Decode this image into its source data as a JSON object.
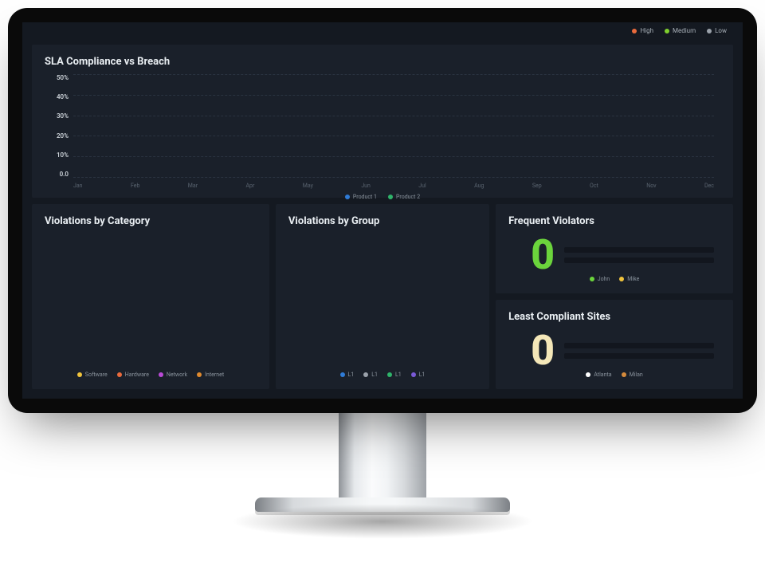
{
  "topLegend": [
    {
      "label": "High",
      "color": "#e96a3c"
    },
    {
      "label": "Medium",
      "color": "#7fcf2e"
    },
    {
      "label": "Low",
      "color": "#9aa1aa"
    }
  ],
  "topTicks": [
    "",
    "",
    "",
    ""
  ],
  "chart_data": {
    "type": "line",
    "title": "SLA Compliance vs Breach",
    "categories": [
      "Jan",
      "Feb",
      "Mar",
      "Apr",
      "May",
      "Jun",
      "Jul",
      "Aug",
      "Sep",
      "Oct",
      "Nov",
      "Dec"
    ],
    "series": [
      {
        "name": "Product 1",
        "color": "#2f7bd6",
        "values": [
          0,
          0,
          0,
          0,
          0,
          0,
          0,
          0,
          0,
          0,
          0,
          0
        ]
      },
      {
        "name": "Product 2",
        "color": "#2fb36a",
        "values": [
          0,
          0,
          0,
          0,
          0,
          0,
          0,
          0,
          0,
          0,
          0,
          0
        ]
      }
    ],
    "yTicks": [
      "50%",
      "40%",
      "30%",
      "20%",
      "10%",
      "0.0"
    ],
    "ylim": [
      0,
      50
    ],
    "ylabel": "",
    "xlabel": ""
  },
  "violationsCategory": {
    "title": "Violations by Category",
    "legend": [
      {
        "label": "Software",
        "color": "#f0c33c"
      },
      {
        "label": "Hardware",
        "color": "#e96a3c"
      },
      {
        "label": "Network",
        "color": "#b94ad6"
      },
      {
        "label": "Internet",
        "color": "#e08a2e"
      }
    ]
  },
  "violationsGroup": {
    "title": "Violations by Group",
    "legend": [
      {
        "label": "L1",
        "color": "#2f7bd6"
      },
      {
        "label": "L1",
        "color": "#9aa1aa"
      },
      {
        "label": "L1",
        "color": "#2fb36a"
      },
      {
        "label": "L1",
        "color": "#7a5ad6"
      }
    ]
  },
  "frequentViolators": {
    "title": "Frequent Violators",
    "value": "0",
    "legend": [
      {
        "label": "John",
        "color": "#6bd43c"
      },
      {
        "label": "Mike",
        "color": "#f0c33c"
      }
    ]
  },
  "leastCompliantSites": {
    "title": "Least Compliant Sites",
    "value": "0",
    "legend": [
      {
        "label": "Atlanta",
        "color": "#ffffff"
      },
      {
        "label": "Milan",
        "color": "#d48a3c"
      }
    ]
  }
}
